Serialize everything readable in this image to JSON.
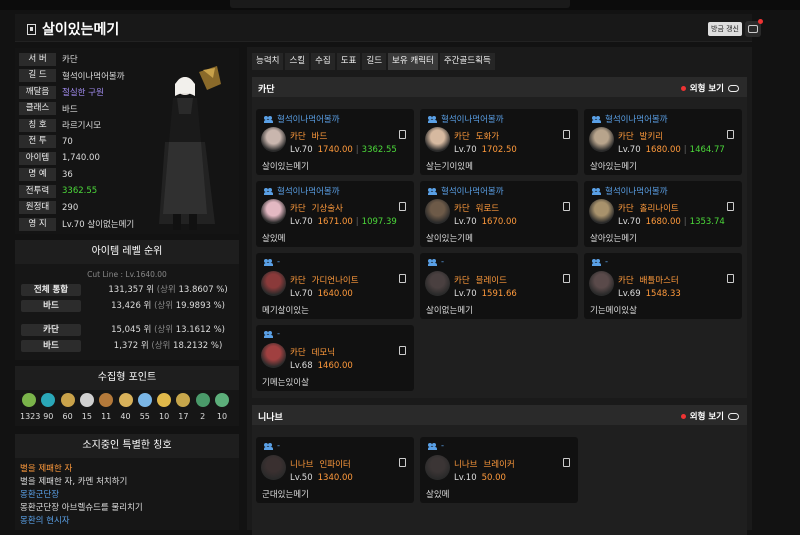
{
  "header": {
    "title": "살이있는메기",
    "refresh_label": "방금 갱신"
  },
  "profile": {
    "rows": [
      {
        "k": "서 버",
        "v": "카단",
        "color": "#dddddd"
      },
      {
        "k": "길 드",
        "v": "혈석이나먹어볼까",
        "color": "#dddddd"
      },
      {
        "k": "깨달음",
        "v": "절실한 구원",
        "color": "#a28cf0"
      },
      {
        "k": "클래스",
        "v": "바드",
        "color": "#dddddd"
      },
      {
        "k": "칭 호",
        "v": "라르기시모",
        "color": "#dddddd"
      },
      {
        "k": "전 투",
        "v": "70",
        "color": "#dddddd"
      },
      {
        "k": "아이템",
        "v": "1,740.00",
        "color": "#dddddd"
      },
      {
        "k": "명 예",
        "v": "36",
        "color": "#dddddd"
      },
      {
        "k": "전투력",
        "v": "3362.55",
        "color": "#4cd93a"
      },
      {
        "k": "원정대",
        "v": "290",
        "color": "#dddddd"
      },
      {
        "k": "영 지",
        "v": "Lv.70 살이없는메기",
        "color": "#dddddd"
      }
    ]
  },
  "item_rank": {
    "title": "아이템 레벨 순위",
    "cutline": "Cut Line : Lv.1640.00",
    "rows": [
      {
        "k": "전체 통합",
        "rank": "131,357 위",
        "pct": "13.8607 %"
      },
      {
        "k": "바드",
        "rank": "13,426 위",
        "pct": "19.9893 %"
      },
      {
        "k": "카단",
        "rank": "15,045 위",
        "pct": "13.1612 %"
      },
      {
        "k": "바드",
        "rank": "1,372 위",
        "pct": "18.2132 %"
      }
    ],
    "upper_label": "(상위"
  },
  "collect": {
    "title": "수집형 포인트",
    "items": [
      {
        "icon": "mokoko-seed-icon",
        "n": "1323",
        "color": "#7ab34a"
      },
      {
        "icon": "island-heart-icon",
        "n": "90",
        "color": "#2aa7b8"
      },
      {
        "icon": "giant-heart-icon",
        "n": "60",
        "color": "#c9a24a"
      },
      {
        "icon": "art-icon",
        "n": "15",
        "color": "#cfcfcf"
      },
      {
        "icon": "ignea-icon",
        "n": "11",
        "color": "#b3793a"
      },
      {
        "icon": "star-icon",
        "n": "40",
        "color": "#d8b15a"
      },
      {
        "icon": "voyage-icon",
        "n": "55",
        "color": "#7ab6e6"
      },
      {
        "icon": "memory-icon",
        "n": "10",
        "color": "#e0b84a"
      },
      {
        "icon": "leaf-icon",
        "n": "17",
        "color": "#c7a64b"
      },
      {
        "icon": "orpheus-icon",
        "n": "2",
        "color": "#4a9a6a"
      },
      {
        "icon": "seed-icon",
        "n": "10",
        "color": "#5cae7a"
      }
    ]
  },
  "titles": {
    "title": "소지중인 특별한 칭호",
    "items": [
      {
        "name": "별을 제패한 자",
        "desc": "별을 제패한 자, 카멘 처치하기",
        "color": "#ff9a3c"
      },
      {
        "name": "몽환군단장",
        "desc": "몽환군단장 아브렐슈드를 물리치기",
        "color": "#5aa0e6"
      },
      {
        "name": "몽환의 현시자",
        "desc": "",
        "color": "#5aa0e6"
      }
    ]
  },
  "tabs": [
    "능력치",
    "스킬",
    "수집",
    "도표",
    "길드",
    "보유 캐릭터",
    "주간골드획득"
  ],
  "active_tab": 5,
  "view_label": "외형 보기",
  "servers": [
    {
      "name": "카단",
      "cards": [
        {
          "guild": "혈석이나먹어볼까",
          "server": "카단",
          "cls": "바드",
          "lv": "Lv.70",
          "il": "1740.00",
          "cp": "3362.55",
          "nick": "살이있는메기",
          "av": "#c9b6ae"
        },
        {
          "guild": "혈석이나먹어볼까",
          "server": "카단",
          "cls": "도화가",
          "lv": "Lv.70",
          "il": "1702.50",
          "cp": "",
          "nick": "살는기이있메",
          "av": "#d6b9a0"
        },
        {
          "guild": "혈석이나먹어볼까",
          "server": "카단",
          "cls": "발키리",
          "lv": "Lv.70",
          "il": "1680.00",
          "cp": "1464.77",
          "nick": "살아있는메기",
          "av": "#b8a48c"
        },
        {
          "guild": "혈석이나먹어볼까",
          "server": "카단",
          "cls": "기상술사",
          "lv": "Lv.70",
          "il": "1671.00",
          "cp": "1097.39",
          "nick": "살있메",
          "av": "#e3b8c2"
        },
        {
          "guild": "혈석이나먹어볼까",
          "server": "카단",
          "cls": "워로드",
          "lv": "Lv.70",
          "il": "1670.00",
          "cp": "",
          "nick": "살이있는기메",
          "av": "#6d5a48"
        },
        {
          "guild": "혈석이나먹어볼까",
          "server": "카단",
          "cls": "홀리나이트",
          "lv": "Lv.70",
          "il": "1680.00",
          "cp": "1353.74",
          "nick": "살아있는메기",
          "av": "#a8926c"
        },
        {
          "guild": "-",
          "server": "카단",
          "cls": "가디언나이트",
          "lv": "Lv.70",
          "il": "1640.00",
          "cp": "",
          "nick": "메기살이있는",
          "av": "#8a3a3a"
        },
        {
          "guild": "-",
          "server": "카단",
          "cls": "블레이드",
          "lv": "Lv.70",
          "il": "1591.66",
          "cp": "",
          "nick": "살이없는메기",
          "av": "#4a4040"
        },
        {
          "guild": "-",
          "server": "카단",
          "cls": "배틀마스터",
          "lv": "Lv.69",
          "il": "1548.33",
          "cp": "",
          "nick": "기는메이있살",
          "av": "#5a4a4a"
        },
        {
          "guild": "-",
          "server": "카단",
          "cls": "데모닉",
          "lv": "Lv.68",
          "il": "1460.00",
          "cp": "",
          "nick": "기메는있이살",
          "av": "#a04040"
        }
      ]
    },
    {
      "name": "니나브",
      "cards": [
        {
          "guild": "-",
          "server": "니나브",
          "cls": "인파이터",
          "lv": "Lv.50",
          "il": "1340.00",
          "cp": "",
          "nick": "군대있는메기",
          "av": "#3a3030"
        },
        {
          "guild": "-",
          "server": "니나브",
          "cls": "브레이커",
          "lv": "Lv.10",
          "il": "50.00",
          "cp": "",
          "nick": "살있메",
          "av": "#3b3535"
        }
      ]
    }
  ]
}
